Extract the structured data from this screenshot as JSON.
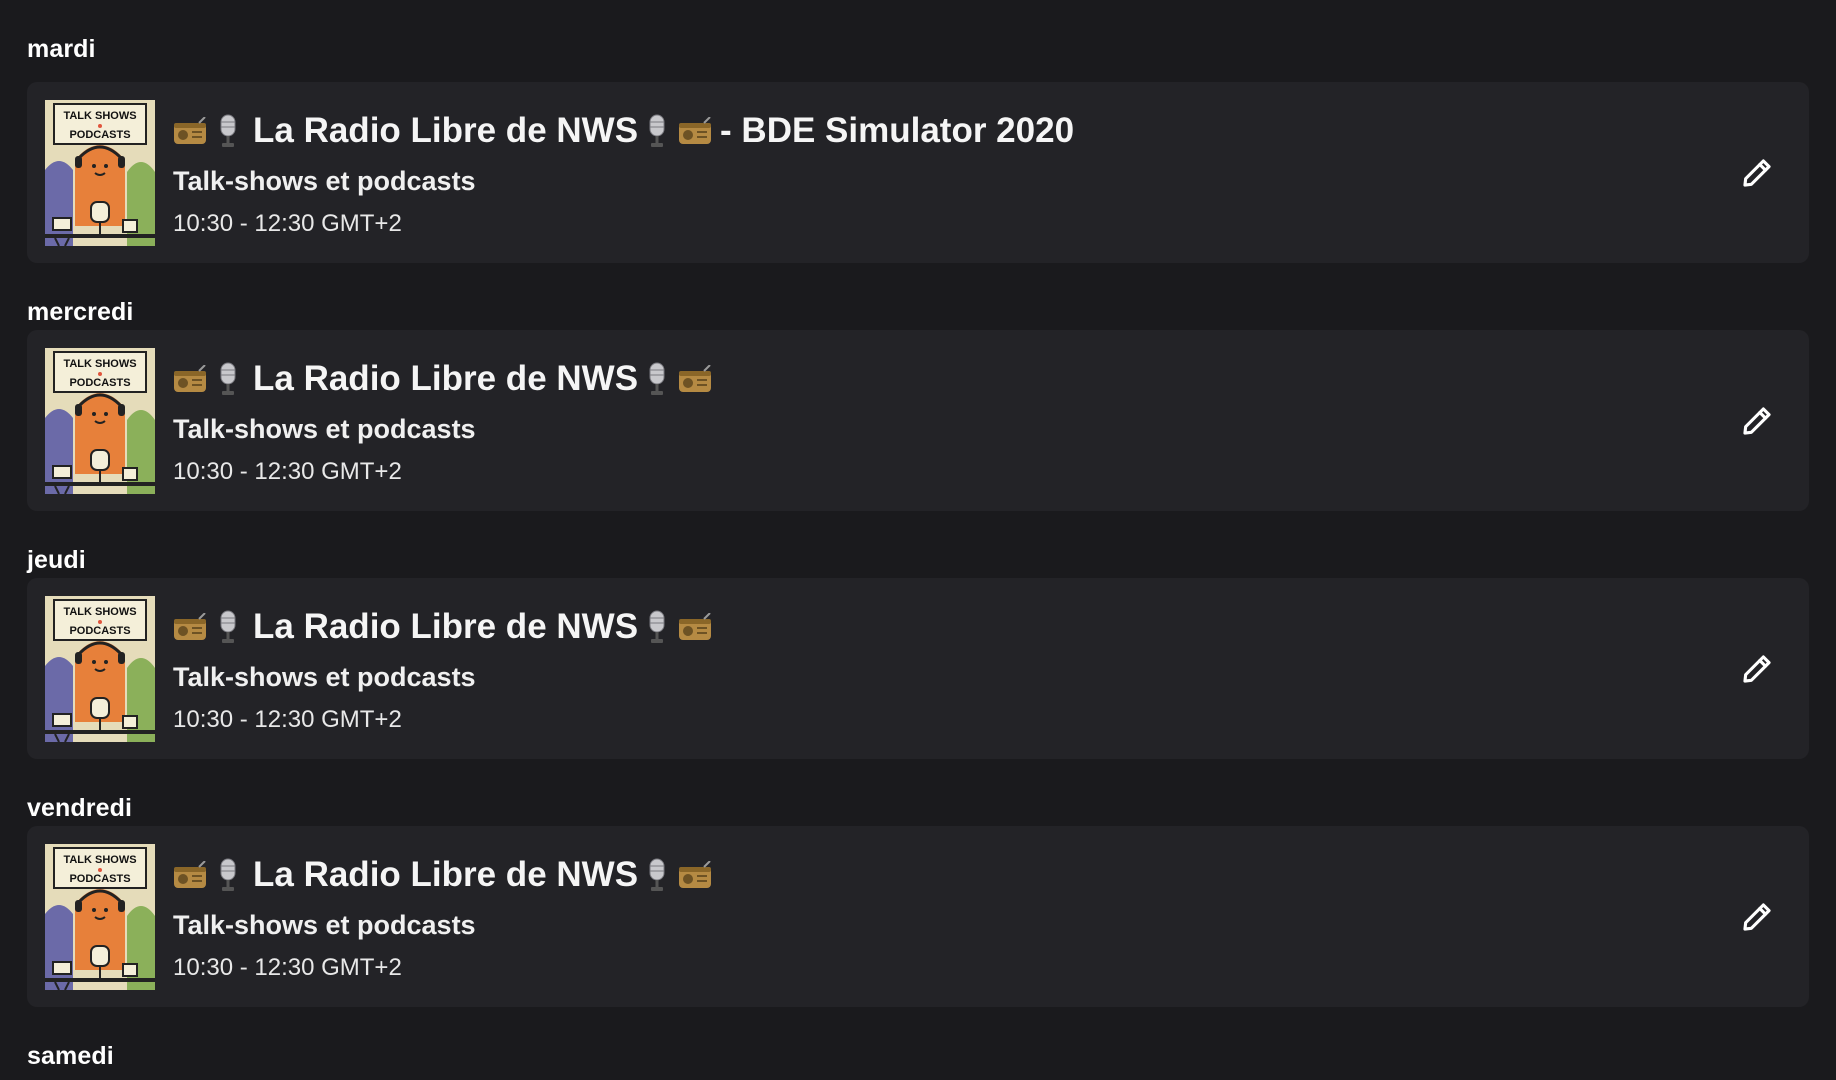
{
  "days": [
    {
      "label": "mardi",
      "show": {
        "title": "La Radio Libre de NWS",
        "suffix": "- BDE Simulator 2020",
        "category": "Talk-shows et podcasts",
        "time": "10:30 - 12:30 GMT+2",
        "thumbnail_text_top": "TALK SHOWS",
        "thumbnail_text_bottom": "PODCASTS"
      }
    },
    {
      "label": "mercredi",
      "show": {
        "title": "La Radio Libre de NWS",
        "suffix": "",
        "category": "Talk-shows et podcasts",
        "time": "10:30 - 12:30 GMT+2",
        "thumbnail_text_top": "TALK SHOWS",
        "thumbnail_text_bottom": "PODCASTS"
      }
    },
    {
      "label": "jeudi",
      "show": {
        "title": "La Radio Libre de NWS",
        "suffix": "",
        "category": "Talk-shows et podcasts",
        "time": "10:30 - 12:30 GMT+2",
        "thumbnail_text_top": "TALK SHOWS",
        "thumbnail_text_bottom": "PODCASTS"
      }
    },
    {
      "label": "vendredi",
      "show": {
        "title": "La Radio Libre de NWS",
        "suffix": "",
        "category": "Talk-shows et podcasts",
        "time": "10:30 - 12:30 GMT+2",
        "thumbnail_text_top": "TALK SHOWS",
        "thumbnail_text_bottom": "PODCASTS"
      }
    }
  ],
  "trailing_day": {
    "label": "samedi"
  },
  "icons": {
    "radio": "radio-icon",
    "microphone": "microphone-icon",
    "edit": "pencil-icon"
  },
  "colors": {
    "background": "#1a1a1d",
    "card": "#232327",
    "text": "#ffffff"
  }
}
